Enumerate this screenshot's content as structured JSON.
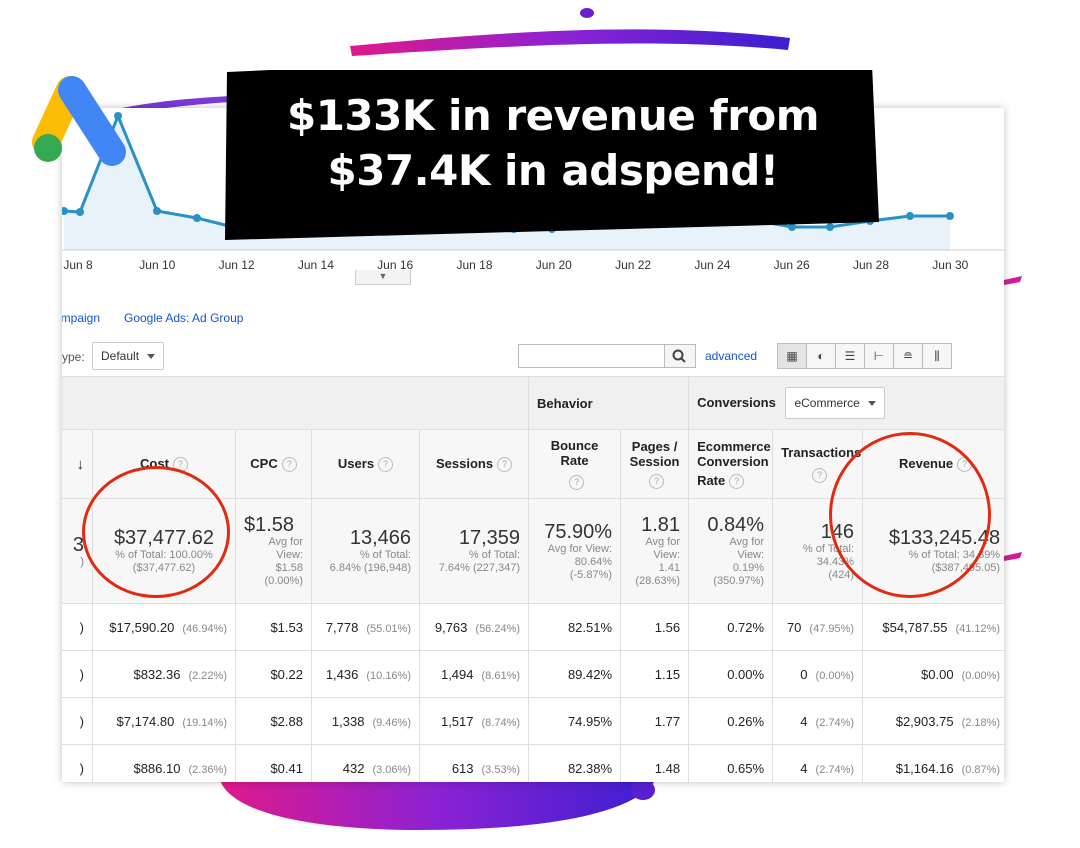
{
  "banner": {
    "line1": "$133K in revenue from",
    "line2": "$37.4K in adspend!"
  },
  "colors": {
    "accent_red": "#e02a12",
    "link_blue": "#1155cc",
    "line_blue": "#2a90c8",
    "banner_bg": "#000000"
  },
  "logo": {
    "icon": "google-ads-logo-icon"
  },
  "chart_data": {
    "type": "line",
    "x_tick_labels": [
      "Jun 8",
      "Jun 10",
      "Jun 12",
      "Jun 14",
      "Jun 16",
      "Jun 18",
      "Jun 20",
      "Jun 22",
      "Jun 24",
      "Jun 26",
      "Jun 28",
      "Jun 30"
    ],
    "grid": false
  },
  "dimension_links": [
    "ampaign",
    "Google Ads: Ad Group"
  ],
  "controls": {
    "type_label": "ype:",
    "type_value": "Default",
    "search_value": "",
    "advanced_label": "advanced",
    "view_icons": [
      "table-icon",
      "pie-icon",
      "bar-icon",
      "comparison-icon",
      "term-cloud-icon",
      "pivot-icon"
    ]
  },
  "table": {
    "groups": {
      "behavior": "Behavior",
      "conversions": "Conversions",
      "conversions_select": "eCommerce"
    },
    "headers": {
      "sort": "↓",
      "cost": "Cost",
      "cpc": "CPC",
      "users": "Users",
      "sessions": "Sessions",
      "bounce": "Bounce Rate",
      "pages_line1": "Pages /",
      "pages_line2": "Session",
      "conv_line1": "Ecommerce",
      "conv_line2": "Conversion",
      "conv_line3": "Rate",
      "transactions": "Transactions",
      "revenue": "Revenue"
    },
    "totals": {
      "dim": {
        "big": "3",
        "sub": ")"
      },
      "cost": {
        "big": "$37,477.62",
        "sub": [
          "% of Total: 100.00%",
          "($37,477.62)"
        ]
      },
      "cpc": {
        "big": "$1.58",
        "sub": [
          "Avg for",
          "View:",
          "$1.58",
          "(0.00%)"
        ]
      },
      "users": {
        "big": "13,466",
        "sub": [
          "% of Total:",
          "6.84% (196,948)"
        ]
      },
      "sessions": {
        "big": "17,359",
        "sub": [
          "% of Total:",
          "7.64% (227,347)"
        ]
      },
      "bounce": {
        "big": "75.90%",
        "sub": [
          "Avg for View:",
          "80.64%",
          "(-5.87%)"
        ]
      },
      "pages": {
        "big": "1.81",
        "sub": [
          "Avg for",
          "View:",
          "1.41",
          "(28.63%)"
        ]
      },
      "conv": {
        "big": "0.84%",
        "sub": [
          "Avg for",
          "View:",
          "0.19%",
          "(350.97%)"
        ]
      },
      "transactions": {
        "big": "146",
        "sub": [
          "% of Total:",
          "34.43%",
          "(424)"
        ]
      },
      "revenue": {
        "big": "$133,245.48",
        "sub": [
          "% of Total: 34.39%",
          "($387,495.05)"
        ]
      }
    },
    "rows": [
      {
        "dim": ")",
        "cost": "$17,590.20",
        "cost_pct": "(46.94%)",
        "cpc": "$1.53",
        "users": "7,778",
        "users_pct": "(55.01%)",
        "sessions": "9,763",
        "sessions_pct": "(56.24%)",
        "bounce": "82.51%",
        "pages": "1.56",
        "conv": "0.72%",
        "trans": "70",
        "trans_pct": "(47.95%)",
        "revenue": "$54,787.55",
        "revenue_pct": "(41.12%)"
      },
      {
        "dim": ")",
        "cost": "$832.36",
        "cost_pct": "(2.22%)",
        "cpc": "$0.22",
        "users": "1,436",
        "users_pct": "(10.16%)",
        "sessions": "1,494",
        "sessions_pct": "(8.61%)",
        "bounce": "89.42%",
        "pages": "1.15",
        "conv": "0.00%",
        "trans": "0",
        "trans_pct": "(0.00%)",
        "revenue": "$0.00",
        "revenue_pct": "(0.00%)"
      },
      {
        "dim": ")",
        "cost": "$7,174.80",
        "cost_pct": "(19.14%)",
        "cpc": "$2.88",
        "users": "1,338",
        "users_pct": "(9.46%)",
        "sessions": "1,517",
        "sessions_pct": "(8.74%)",
        "bounce": "74.95%",
        "pages": "1.77",
        "conv": "0.26%",
        "trans": "4",
        "trans_pct": "(2.74%)",
        "revenue": "$2,903.75",
        "revenue_pct": "(2.18%)"
      },
      {
        "dim": ")",
        "cost": "$886.10",
        "cost_pct": "(2.36%)",
        "cpc": "$0.41",
        "users": "432",
        "users_pct": "(3.06%)",
        "sessions": "613",
        "sessions_pct": "(3.53%)",
        "bounce": "82.38%",
        "pages": "1.48",
        "conv": "0.65%",
        "trans": "4",
        "trans_pct": "(2.74%)",
        "revenue": "$1,164.16",
        "revenue_pct": "(0.87%)"
      }
    ]
  }
}
